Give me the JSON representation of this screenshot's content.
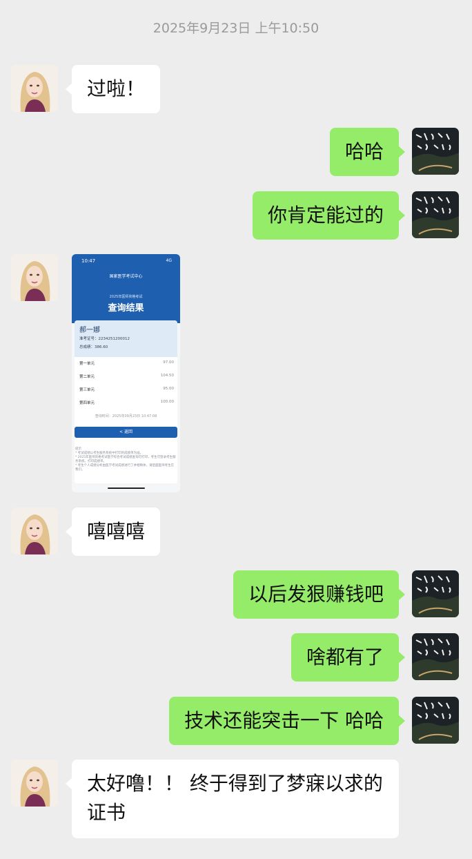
{
  "timestamp": "2025年9月23日 上午10:50",
  "colors": {
    "background": "#ededed",
    "incoming": "#ffffff",
    "outgoing": "#95ec69"
  },
  "messages": [
    {
      "side": "in",
      "text": "过啦！"
    },
    {
      "side": "out",
      "text": "哈哈"
    },
    {
      "side": "out",
      "text": "你肯定能过的"
    },
    {
      "side": "in",
      "type": "image",
      "text": ""
    },
    {
      "side": "in",
      "text": "嘻嘻嘻"
    },
    {
      "side": "out",
      "text": "以后发狠赚钱吧"
    },
    {
      "side": "out",
      "text": "啥都有了"
    },
    {
      "side": "out",
      "text": "技术还能突击一下 哈哈"
    },
    {
      "side": "in",
      "text": "太好噜！！ 终于得到了梦寐以求的证书"
    }
  ],
  "screenshot": {
    "status_time": "10:47",
    "status_right": "4G",
    "nav_title": "国家医学考试中心",
    "subtitle": "2025年医师资格考试",
    "heading": "查询结果",
    "name": "郝一娜",
    "ticket_label": "准考证号：",
    "ticket_no": "2234251200012",
    "total_label": "总成绩：",
    "total": "386.60",
    "units": [
      {
        "label": "第一单元",
        "value": "97.00"
      },
      {
        "label": "第二单元",
        "value": "104.50"
      },
      {
        "label": "第三单元",
        "value": "95.00"
      },
      {
        "label": "第四单元",
        "value": "100.00"
      }
    ],
    "query_time": "查询时间：2025年09月23日 10:47:08",
    "back_button": "< 返回",
    "tips": "提示\n* 考试成绩以考生服务系统中打印的成绩单为准。\n* 2025年医师资格考试医学综合考试成绩查询可打印，考生可登录考生服务系统，打印成绩单。\n* 考生个人成绩分析由医学考试成绩进行了并相映体，请后面医师考生在我们。"
  },
  "right_avatar_text": "道路是曲折的 前途是光明的"
}
